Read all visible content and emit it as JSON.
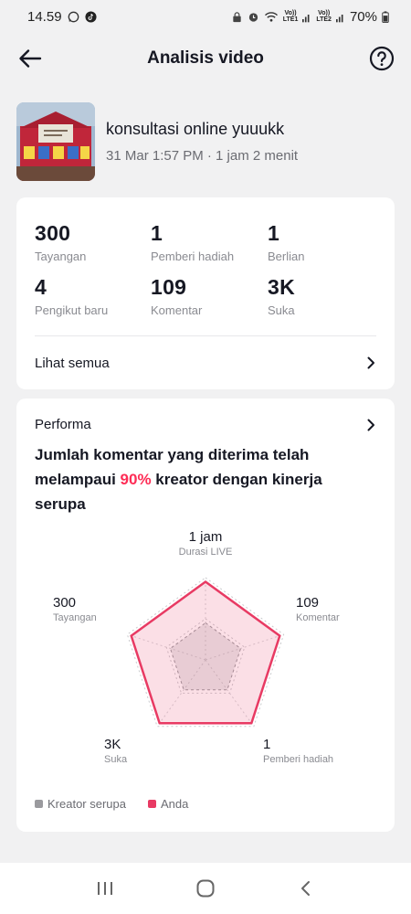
{
  "status_bar": {
    "time": "14.59",
    "battery": "70%",
    "net1": "LTE1",
    "net2": "LTE2",
    "volte": "Vo))"
  },
  "header": {
    "title": "Analisis video"
  },
  "video": {
    "title": "konsultasi online yuuukk",
    "meta": "31 Mar 1:57 PM · 1 jam 2 menit"
  },
  "stats": [
    {
      "value": "300",
      "label": "Tayangan"
    },
    {
      "value": "1",
      "label": "Pemberi hadiah"
    },
    {
      "value": "1",
      "label": "Berlian"
    },
    {
      "value": "4",
      "label": "Pengikut baru"
    },
    {
      "value": "109",
      "label": "Komentar"
    },
    {
      "value": "3K",
      "label": "Suka"
    }
  ],
  "see_all": {
    "label": "Lihat semua"
  },
  "performance": {
    "title": "Performa",
    "text_before": "Jumlah komentar yang diterima telah melampaui ",
    "highlight": "90%",
    "text_after": " kreator dengan kinerja serupa"
  },
  "chart_data": {
    "type": "radar",
    "axes": [
      {
        "value": "1 jam",
        "label": "Durasi LIVE"
      },
      {
        "value": "109",
        "label": "Komentar"
      },
      {
        "value": "1",
        "label": "Pemberi hadiah"
      },
      {
        "value": "3K",
        "label": "Suka"
      },
      {
        "value": "300",
        "label": "Tayangan"
      }
    ],
    "series": [
      {
        "name": "Kreator serupa",
        "color": "#9a9a9e",
        "values": [
          0.45,
          0.45,
          0.45,
          0.45,
          0.45
        ]
      },
      {
        "name": "Anda",
        "color": "#e83a63",
        "values": [
          0.95,
          0.95,
          0.95,
          0.95,
          0.95
        ]
      }
    ],
    "legend_position": "bottom-left"
  },
  "colors": {
    "accent": "#fe2c55",
    "anda": "#e83a63",
    "kreator_serupa": "#9a9a9e"
  },
  "icons": {
    "back": "arrow-left-icon",
    "help": "question-circle-icon",
    "chevron": "chevron-right-icon"
  }
}
